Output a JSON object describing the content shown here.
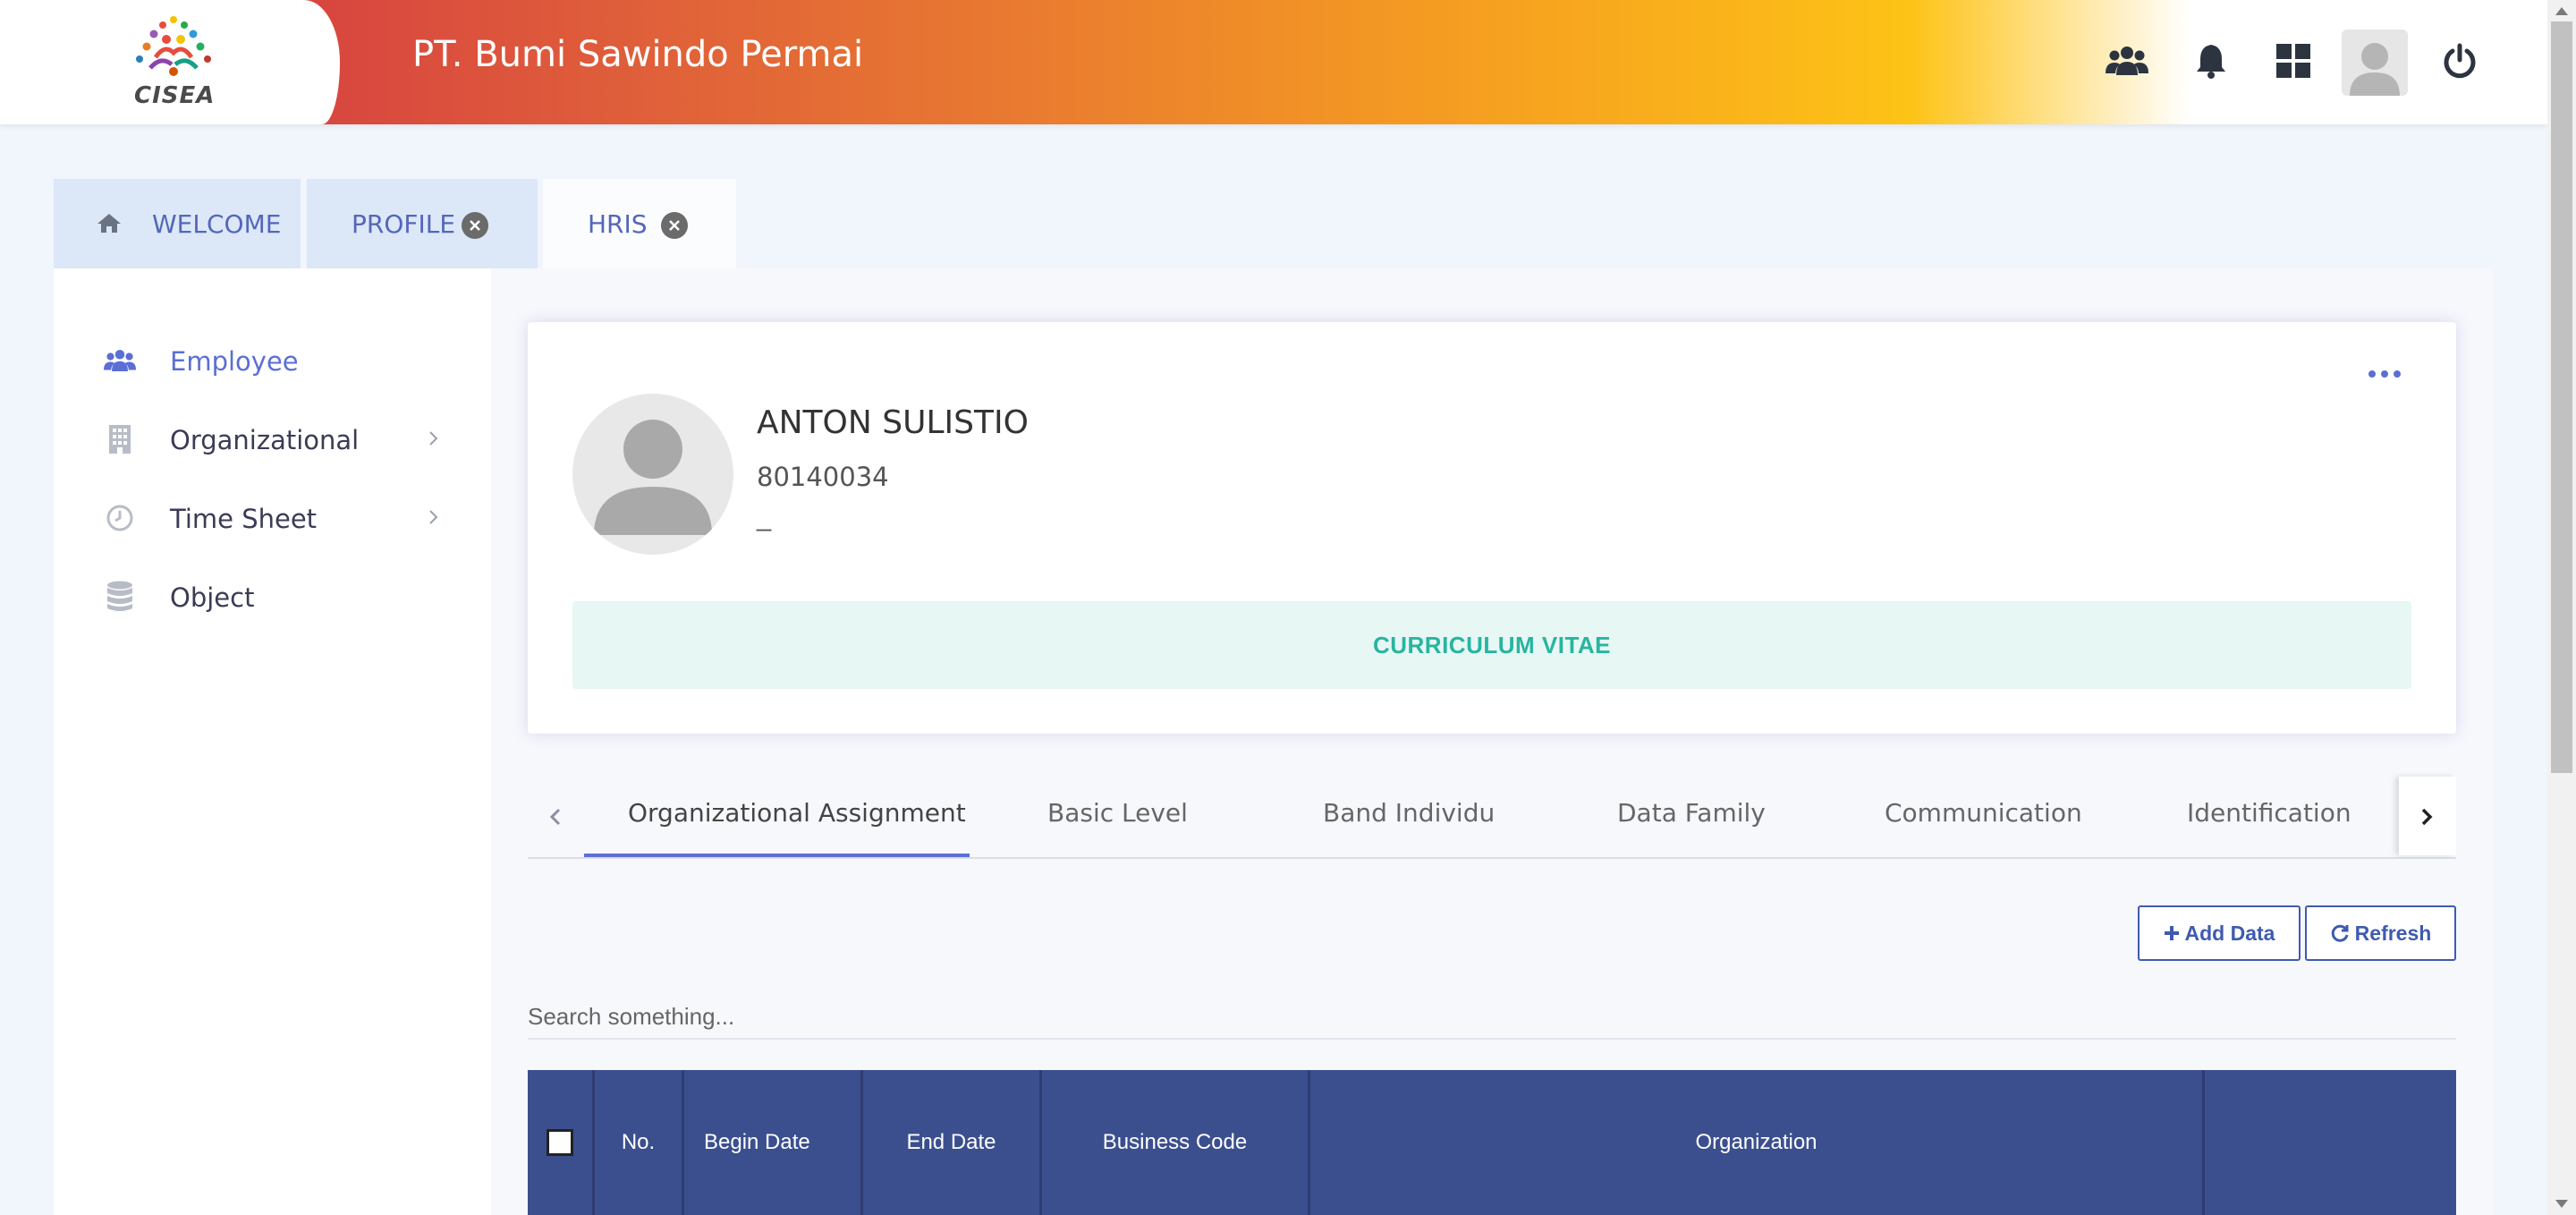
{
  "header": {
    "logo_text": "CISEA",
    "company_name": "PT. Bumi Sawindo Permai",
    "icons": [
      "users-icon",
      "bell-icon",
      "grid-icon",
      "avatar",
      "power-icon"
    ]
  },
  "tabs": [
    {
      "label": "WELCOME",
      "icon": "home-icon",
      "closable": false,
      "active": false
    },
    {
      "label": "PROFILE",
      "closable": true,
      "active": false
    },
    {
      "label": "HRIS",
      "closable": true,
      "active": true
    }
  ],
  "sidebar": {
    "items": [
      {
        "label": "Employee",
        "icon": "users-icon",
        "selected": true,
        "has_children": false
      },
      {
        "label": "Organizational",
        "icon": "building-icon",
        "selected": false,
        "has_children": true
      },
      {
        "label": "Time Sheet",
        "icon": "clock-icon",
        "selected": false,
        "has_children": true
      },
      {
        "label": "Object",
        "icon": "database-icon",
        "selected": false,
        "has_children": false
      }
    ]
  },
  "profile": {
    "name": "ANTON SULISTIO",
    "employee_id": "80140034",
    "subtitle": "_",
    "cv_button": "CURRICULUM VITAE"
  },
  "subtabs": {
    "items": [
      "Organizational Assignment",
      "Basic Level",
      "Band Individu",
      "Data Family",
      "Communication",
      "Identification"
    ],
    "selected": "Organizational Assignment"
  },
  "actions": {
    "add_label": "Add Data",
    "refresh_label": "Refresh"
  },
  "search": {
    "placeholder": "Search something..."
  },
  "table": {
    "columns": [
      "No.",
      "Begin Date",
      "End Date",
      "Business Code",
      "Organization",
      ""
    ]
  },
  "colors": {
    "accent": "#5b6ed6",
    "table_header": "#3b4f8f",
    "cv_text": "#28b5a0",
    "cv_bg": "#e6f7f4"
  }
}
